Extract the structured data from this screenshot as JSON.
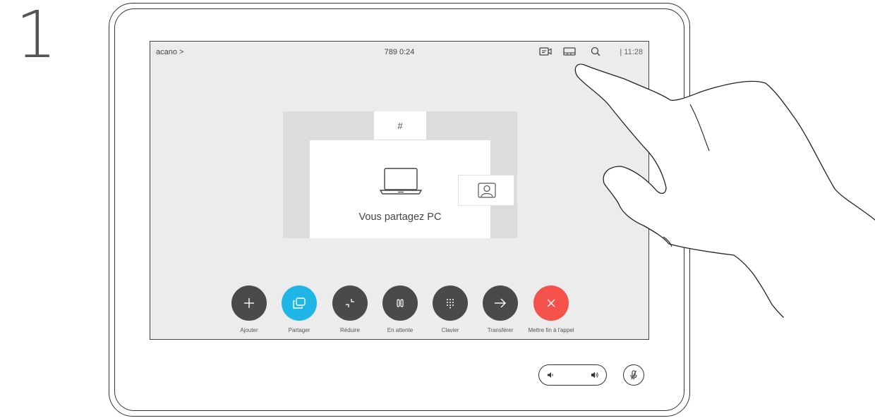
{
  "step": {
    "number": "1"
  },
  "status_bar": {
    "site": "acano >",
    "call_info": "789  0:24",
    "clock": "|  11:28",
    "icons": [
      "camera-icon",
      "layout-icon",
      "search-icon"
    ]
  },
  "share": {
    "hash_tile": "#",
    "message": "Vous partagez PC"
  },
  "controls": [
    {
      "id": "add",
      "label": "Ajouter",
      "icon": "plus-icon",
      "color": "#4a4a4a"
    },
    {
      "id": "share",
      "label": "Partager",
      "icon": "share-screen-icon",
      "color": "#1fb6e6"
    },
    {
      "id": "minimize",
      "label": "Réduire",
      "icon": "minimize-icon",
      "color": "#4a4a4a"
    },
    {
      "id": "hold",
      "label": "En attente",
      "icon": "pause-icon",
      "color": "#4a4a4a"
    },
    {
      "id": "keypad",
      "label": "Clavier",
      "icon": "keypad-icon",
      "color": "#4a4a4a"
    },
    {
      "id": "transfer",
      "label": "Transférer",
      "icon": "arrow-right-icon",
      "color": "#4a4a4a"
    },
    {
      "id": "end-call",
      "label": "Mettre fin à l'appel",
      "icon": "close-icon",
      "color": "#f4524b"
    }
  ]
}
